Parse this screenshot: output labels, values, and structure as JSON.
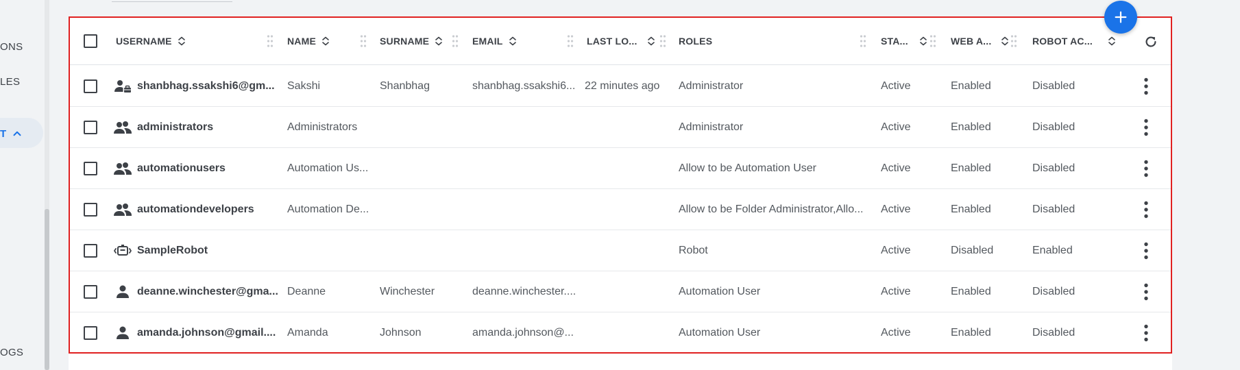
{
  "sidebar": {
    "items": [
      {
        "label": "ONS"
      },
      {
        "label": "LES"
      },
      {
        "label": "T"
      },
      {
        "label": "OGS"
      }
    ]
  },
  "table": {
    "columns": {
      "username": "USERNAME",
      "name": "NAME",
      "surname": "SURNAME",
      "email": "EMAIL",
      "last_login": "LAST LO...",
      "roles": "ROLES",
      "status": "STA...",
      "web_access": "WEB A...",
      "robot_access": "ROBOT AC..."
    },
    "rows": [
      {
        "type": "user-admin",
        "username": "shanbhag.ssakshi6@gm...",
        "name": "Sakshi",
        "surname": "Shanbhag",
        "email": "shanbhag.ssakshi6...",
        "last_login": "22 minutes ago",
        "roles": "Administrator",
        "status": "Active",
        "web_access": "Enabled",
        "robot_access": "Disabled"
      },
      {
        "type": "group",
        "username": "administrators",
        "name": "Administrators",
        "surname": "",
        "email": "",
        "last_login": "",
        "roles": "Administrator",
        "status": "Active",
        "web_access": "Enabled",
        "robot_access": "Disabled"
      },
      {
        "type": "group",
        "username": "automationusers",
        "name": "Automation Us...",
        "surname": "",
        "email": "",
        "last_login": "",
        "roles": "Allow to be Automation User",
        "status": "Active",
        "web_access": "Enabled",
        "robot_access": "Disabled"
      },
      {
        "type": "group",
        "username": "automationdevelopers",
        "name": "Automation De...",
        "surname": "",
        "email": "",
        "last_login": "",
        "roles": "Allow to be Folder Administrator,Allo...",
        "status": "Active",
        "web_access": "Enabled",
        "robot_access": "Disabled"
      },
      {
        "type": "robot",
        "username": "SampleRobot",
        "name": "",
        "surname": "",
        "email": "",
        "last_login": "",
        "roles": "Robot",
        "status": "Active",
        "web_access": "Disabled",
        "robot_access": "Enabled"
      },
      {
        "type": "user",
        "username": "deanne.winchester@gma...",
        "name": "Deanne",
        "surname": "Winchester",
        "email": "deanne.winchester....",
        "last_login": "",
        "roles": "Automation User",
        "status": "Active",
        "web_access": "Enabled",
        "robot_access": "Disabled"
      },
      {
        "type": "user",
        "username": "amanda.johnson@gmail....",
        "name": "Amanda",
        "surname": "Johnson",
        "email": "amanda.johnson@...",
        "last_login": "",
        "roles": "Automation User",
        "status": "Active",
        "web_access": "Enabled",
        "robot_access": "Disabled"
      }
    ]
  },
  "icons": {
    "add": "plus-icon",
    "refresh": "refresh-icon",
    "more": "more-vertical-icon",
    "sort": "sort-icon",
    "drag": "drag-handle-icon",
    "chevron": "chevron-up-icon"
  },
  "colors": {
    "accent": "#1a73e8",
    "highlight": "#e02020"
  }
}
